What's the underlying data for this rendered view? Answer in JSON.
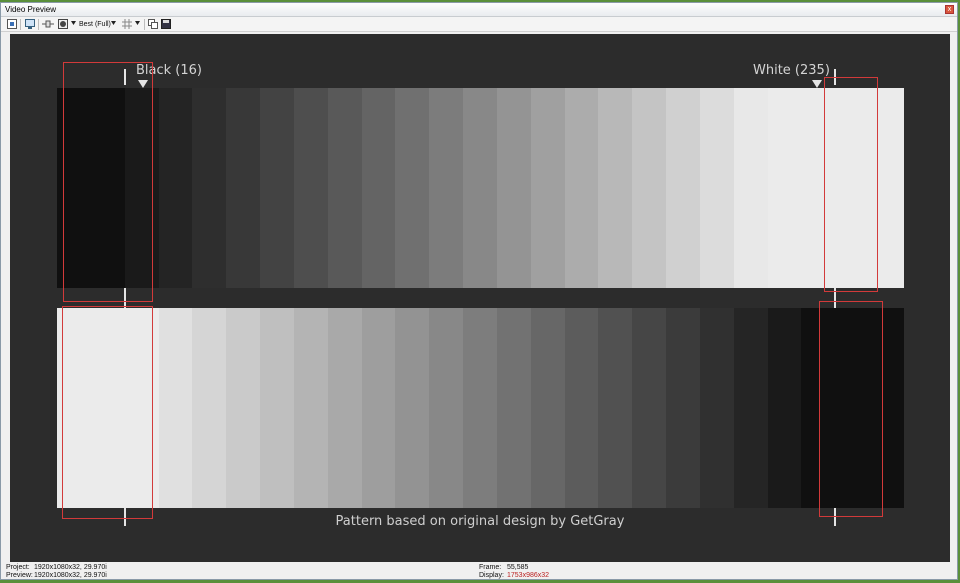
{
  "window": {
    "title": "Video Preview",
    "close_glyph": "x"
  },
  "toolbar": {
    "quality_label": "Best (Full)",
    "icons": [
      "preview-settings-icon",
      "monitor-icon",
      "split-screen-icon",
      "overlay-icon",
      "dropdown-arrow-icon",
      "grid-icon",
      "dropdown-arrow-icon",
      "copy-snapshot-icon",
      "save-snapshot-icon"
    ]
  },
  "preview": {
    "black_label": "Black (16)",
    "white_label": "White (235)",
    "credit": "Pattern based on original design by GetGray",
    "top_band_colors": [
      "#101010",
      "#101010",
      "#1a1a1a",
      "#242424",
      "#2e2e2e",
      "#383838",
      "#434343",
      "#4e4e4e",
      "#595959",
      "#646464",
      "#707070",
      "#7c7c7c",
      "#888888",
      "#949494",
      "#a0a0a0",
      "#acacac",
      "#b8b8b8",
      "#c4c4c4",
      "#d0d0d0",
      "#dcdcdc",
      "#e8e8e8",
      "#ebebeb",
      "#ebebeb",
      "#ebebeb",
      "#ebebeb"
    ],
    "bottom_band_colors": [
      "#ebebeb",
      "#ebebeb",
      "#ebebeb",
      "#e0e0e0",
      "#d5d5d5",
      "#cacaca",
      "#bfbfbf",
      "#b4b4b4",
      "#a9a9a9",
      "#9e9e9e",
      "#939393",
      "#888888",
      "#7d7d7d",
      "#727272",
      "#676767",
      "#5c5c5c",
      "#515151",
      "#464646",
      "#3b3b3b",
      "#303030",
      "#252525",
      "#1a1a1a",
      "#101010",
      "#101010",
      "#101010"
    ]
  },
  "status": {
    "project_label": "Project:",
    "project_value": "1920x1080x32, 29.970i",
    "preview_label": "Preview:",
    "preview_value": "1920x1080x32, 29.970i",
    "frame_label": "Frame:",
    "frame_value": "55,585",
    "display_label": "Display:",
    "display_value": "1753x986x32"
  }
}
